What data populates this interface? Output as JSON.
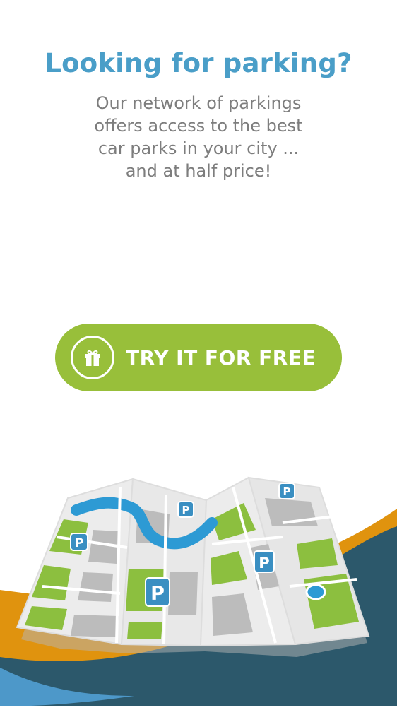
{
  "onboarding": {
    "title": "Looking for parking?",
    "subtitle_lines": [
      "Our network of parkings",
      "offers access to the best",
      "car parks in your city ...",
      "and at half price!"
    ]
  },
  "cta": {
    "label": "TRY IT FOR FREE",
    "icon": "gift-icon"
  },
  "illustration": {
    "icon": "city-map-illustration",
    "parking_marker_label": "P"
  },
  "colors": {
    "title": "#4a9ec8",
    "body_text": "#7d7d7d",
    "cta_background": "#98bf3a",
    "map_green": "#8cbf3f",
    "map_water": "#2d9ad4",
    "marker": "#3a8fc2",
    "wave_orange": "#e0930e",
    "wave_dark": "#2c586b",
    "wave_light_blue": "#4d98c9"
  }
}
